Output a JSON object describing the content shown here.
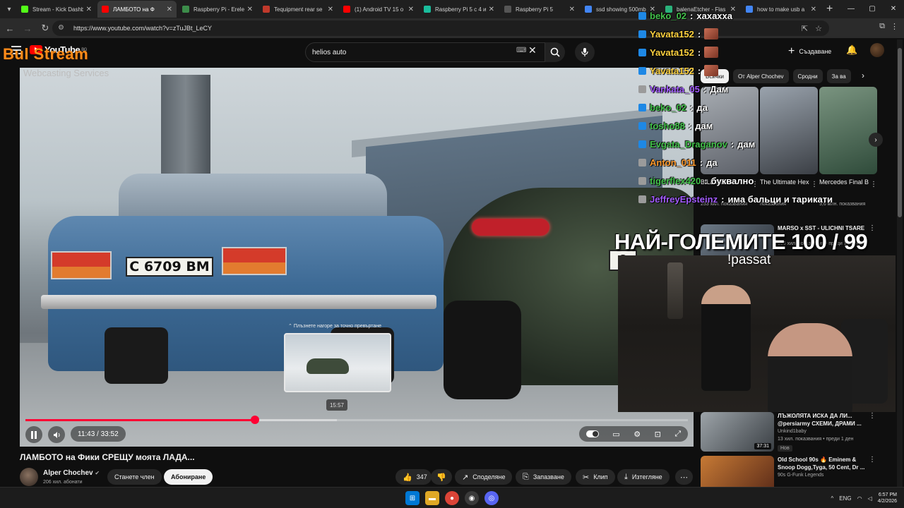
{
  "browser": {
    "tabs": [
      {
        "label": "Stream - Kick Dashb",
        "color": "#53fc18",
        "active": false
      },
      {
        "label": "ЛАМБОТО на Ф",
        "color": "#ff0000",
        "active": true
      },
      {
        "label": "Raspberry Pi - Erele",
        "color": "#3c8c4a",
        "active": false
      },
      {
        "label": "Tequipment rear se",
        "color": "#c0392b",
        "active": false
      },
      {
        "label": "(1) Android TV 15 o",
        "color": "#ff0000",
        "active": false
      },
      {
        "label": "Raspberry Pi 5 с 4 и",
        "color": "#1abc9c",
        "active": false
      },
      {
        "label": "Raspberry Pi 5",
        "color": "#555555",
        "active": false
      },
      {
        "label": "ssd showing 500mb",
        "color": "#4285f4",
        "active": false
      },
      {
        "label": "balenaEtcher - Flas",
        "color": "#2ab27b",
        "active": false
      },
      {
        "label": "how to make usb a",
        "color": "#4285f4",
        "active": false
      }
    ],
    "url": "https://www.youtube.com/watch?v=zTuJBt_LeCY"
  },
  "youtube": {
    "logo_text": "YouTube",
    "country": "BG",
    "search_value": "helios auto",
    "create_label": "Създаване",
    "chips": [
      {
        "label": "Всички",
        "active": true
      },
      {
        "label": "От Alper Chochev",
        "active": false
      },
      {
        "label": "Сродни",
        "active": false
      },
      {
        "label": "За ва",
        "active": false
      }
    ]
  },
  "overlay": {
    "brand": "Bul Stream",
    "brand_sub": "Webcasting Services",
    "goal_text": "НАЙ-ГОЛЕМИТЕ 100 / 99",
    "command": "!passat"
  },
  "player": {
    "current_time": "11:43",
    "duration": "33:52",
    "time_display": "11:43 / 33:52",
    "played_fraction": 0.346,
    "buffered_fraction": 0.47,
    "hover_time": "15:57",
    "hover_fraction": 0.471,
    "hover_hint": "Плъзнете нагоре за точно превъртане",
    "plate_lada": "C 6709 BM",
    "plate_lambo": "8"
  },
  "video": {
    "title": "ЛАМБОТО на Фики СРЕЩУ моята ЛАДА...",
    "channel": "Alper Chochev",
    "subscribers": "206 хил. абонати",
    "join_label": "Станете член",
    "subscribe_label": "Абониране",
    "likes": "347",
    "share_label": "Споделяне",
    "save_label": "Запазване",
    "clip_label": "Клип",
    "download_label": "Изтегляне"
  },
  "shorts": [
    {
      "title": "BILLIONAI...",
      "views": "253 хил. показвания",
      "color_a": "#5c6068",
      "color_b": "#a8adb3"
    },
    {
      "title": "The Ultimate Hexagon ...",
      "views": "показвания",
      "color_a": "#3b3f45",
      "color_b": "#9aa3ad"
    },
    {
      "title": "Mercedes Final Boss ...",
      "views": "9,6 млн. показвания",
      "color_a": "#2f4b3a",
      "color_b": "#7a9480"
    }
  ],
  "recommendations": [
    {
      "title": "MARSO x SST - ULICHNI TSARE",
      "channel": "",
      "meta": "596 хил. показвания • преди 1 месец",
      "duration": "",
      "badge": "",
      "color_a": "#2a2f36",
      "color_b": "#6e7b88"
    },
    {
      "title": "ЛЪЖОЛЯТА ИСКА ДА ЛИ... @persiarmy СХЕМИ, ДРАМИ ...",
      "channel": "Unkind1baby",
      "meta": "13 хил. показвания • преди 1 ден",
      "duration": "37:31",
      "badge": "Нов",
      "color_a": "#3a3f44",
      "color_b": "#9da4a9"
    },
    {
      "title": "Old School 90s 🔥 Eminem & Snoop Dogg,Tyga, 50 Cent, Dr ...",
      "channel": "90s G-Funk Legends",
      "meta": "",
      "duration": "",
      "badge": "",
      "color_a": "#5a2a18",
      "color_b": "#c77a35"
    }
  ],
  "chat": [
    {
      "user": "beko_02",
      "color": "#43c14b",
      "badge": "#1e88e5",
      "message": "хахаххa",
      "emote": false
    },
    {
      "user": "Yavata152",
      "color": "#ffd23f",
      "badge": "#1e88e5",
      "message": "",
      "emote": true
    },
    {
      "user": "Yavata152",
      "color": "#ffd23f",
      "badge": "#1e88e5",
      "message": "",
      "emote": true
    },
    {
      "user": "Yavata152",
      "color": "#ffd23f",
      "badge": "#1e88e5",
      "message": "",
      "emote": true
    },
    {
      "user": "Vankata_05",
      "color": "#a35cff",
      "badge": "#9b9b9b",
      "message": "Дам",
      "emote": false
    },
    {
      "user": "beko_02",
      "color": "#43c14b",
      "badge": "#1e88e5",
      "message": "да",
      "emote": false
    },
    {
      "user": "tosho88",
      "color": "#43c14b",
      "badge": "#1e88e5",
      "message": "дам",
      "emote": false
    },
    {
      "user": "Evgata_Draganov",
      "color": "#43c14b",
      "badge": "#1e88e5",
      "message": "дам",
      "emote": false
    },
    {
      "user": "Anton_011",
      "color": "#ff9a2e",
      "badge": "#9b9b9b",
      "message": "да",
      "emote": false
    },
    {
      "user": "tigerflex420",
      "color": "#43c14b",
      "badge": "#9b9b9b",
      "message": "буквално",
      "emote": false
    },
    {
      "user": "JeffreyEpsteinz",
      "color": "#a35cff",
      "badge": "#9b9b9b",
      "message": "има бальци и тарикати",
      "emote": false
    }
  ],
  "taskbar": {
    "language": "ENG",
    "time": "6:57 PM",
    "date": "4/2/2026"
  },
  "colors": {
    "accent_red": "#ff0033",
    "background": "#0f0f0f",
    "brand_orange": "#ff8c1a"
  }
}
